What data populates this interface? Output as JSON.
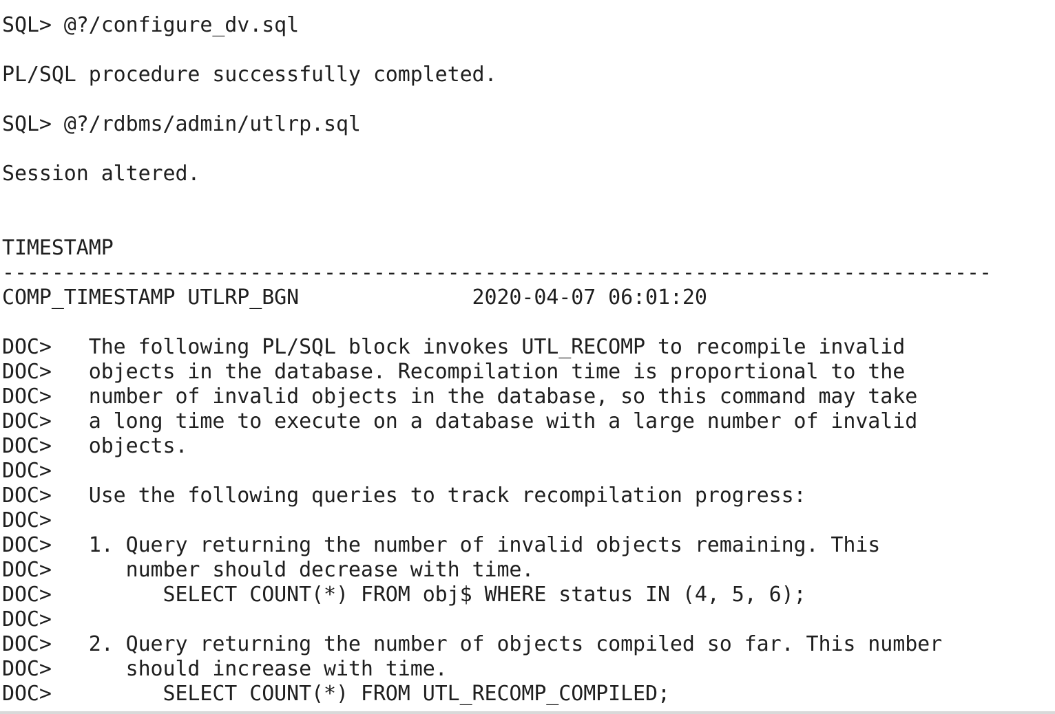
{
  "terminal": {
    "lines": [
      "SQL> @?/configure_dv.sql",
      "",
      "PL/SQL procedure successfully completed.",
      "",
      "SQL> @?/rdbms/admin/utlrp.sql",
      "",
      "Session altered.",
      "",
      "",
      "TIMESTAMP",
      "--------------------------------------------------------------------------------",
      "COMP_TIMESTAMP UTLRP_BGN              2020-04-07 06:01:20",
      "",
      "DOC>   The following PL/SQL block invokes UTL_RECOMP to recompile invalid",
      "DOC>   objects in the database. Recompilation time is proportional to the",
      "DOC>   number of invalid objects in the database, so this command may take",
      "DOC>   a long time to execute on a database with a large number of invalid",
      "DOC>   objects.",
      "DOC>",
      "DOC>   Use the following queries to track recompilation progress:",
      "DOC>",
      "DOC>   1. Query returning the number of invalid objects remaining. This",
      "DOC>      number should decrease with time.",
      "DOC>         SELECT COUNT(*) FROM obj$ WHERE status IN (4, 5, 6);",
      "DOC>",
      "DOC>   2. Query returning the number of objects compiled so far. This number",
      "DOC>      should increase with time.",
      "DOC>         SELECT COUNT(*) FROM UTL_RECOMP_COMPILED;"
    ]
  }
}
